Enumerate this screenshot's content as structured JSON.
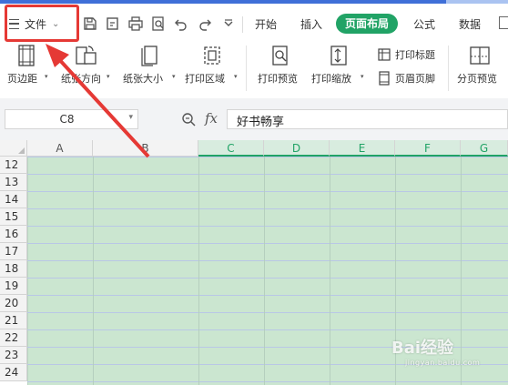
{
  "menubar": {
    "file_label": "文件",
    "tabs": [
      "开始",
      "插入",
      "页面布局",
      "公式",
      "数据"
    ],
    "active_tab": "页面布局"
  },
  "ribbon": {
    "margins": "页边距",
    "orientation": "纸张方向",
    "size": "纸张大小",
    "print_area": "打印区域",
    "print_preview": "打印预览",
    "print_scale": "打印缩放",
    "print_titles": "打印标题",
    "header_footer": "页眉页脚",
    "page_break_preview": "分页预览"
  },
  "formula_bar": {
    "name_box": "C8",
    "fx_label": "fx",
    "content": "好书畅享"
  },
  "sheet": {
    "columns": [
      "A",
      "B",
      "C",
      "D",
      "E",
      "F",
      "G"
    ],
    "selected_columns": [
      "C",
      "D",
      "E",
      "F",
      "G"
    ],
    "rows": [
      "12",
      "13",
      "14",
      "15",
      "16",
      "17",
      "18",
      "19",
      "20",
      "21",
      "22",
      "23",
      "24"
    ]
  },
  "watermark": {
    "brand": "Bai经验",
    "url": "jingyan.baidu.com"
  },
  "colors": {
    "accent": "#21a366",
    "highlight_box": "#e53935",
    "selection_fill": "#cbe6d0"
  }
}
